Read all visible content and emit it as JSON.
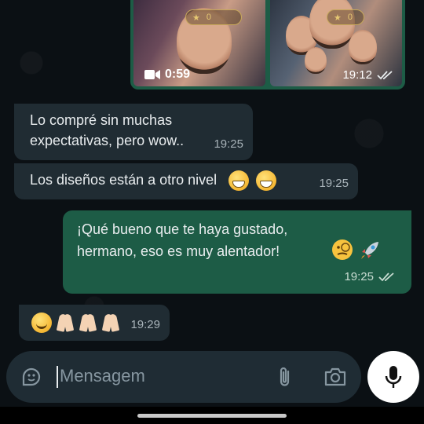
{
  "media_message": {
    "video_duration": "0:59",
    "time": "19:12",
    "status_icon": "double-check-icon"
  },
  "messages": [
    {
      "direction": "in",
      "text": "Lo compré sin muchas expectativas, pero wow..",
      "time": "19:25"
    },
    {
      "direction": "in",
      "text": "Los diseños están a otro nivel",
      "emojis": [
        "grinning-face",
        "grinning-face"
      ],
      "time": "19:25"
    },
    {
      "direction": "out",
      "text": "¡Qué bueno que te haya gustado, hermano, eso es muy alentador!",
      "emojis": [
        "face-with-monocle",
        "rocket"
      ],
      "time": "19:25",
      "status_icon": "double-check-icon"
    },
    {
      "direction": "in",
      "text": "",
      "emojis": [
        "smiling-face",
        "folded-hands",
        "folded-hands",
        "folded-hands"
      ],
      "time": "19:29"
    }
  ],
  "composer": {
    "placeholder": "Mensagem",
    "icons": [
      "sticker-icon",
      "attach-icon",
      "camera-icon",
      "mic-icon"
    ]
  },
  "colors": {
    "outgoing_bubble": "#1d5c46",
    "incoming_bubble": "#202c33",
    "background": "#0b1014",
    "composer": "#1f2c34"
  }
}
